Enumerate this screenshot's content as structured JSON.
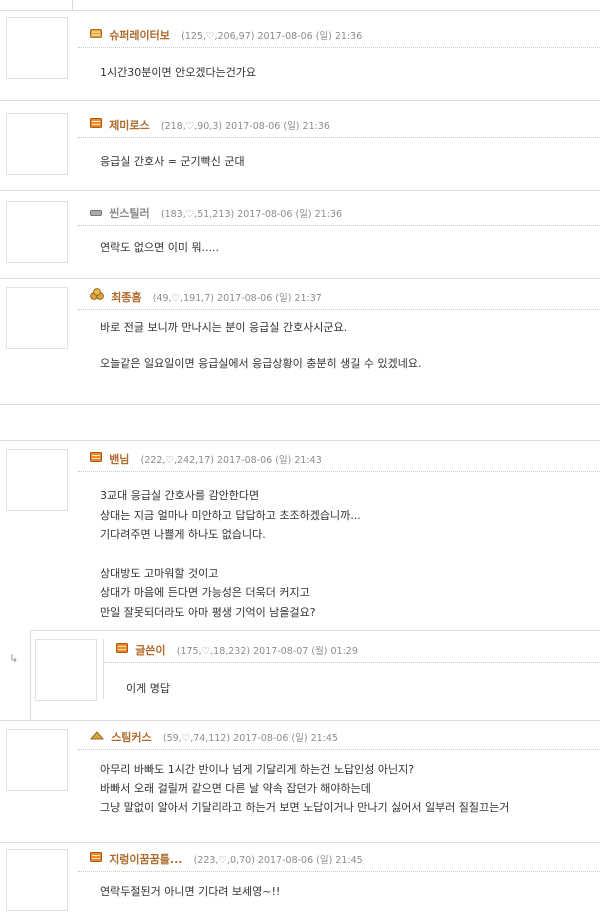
{
  "comments": [
    {
      "nick": "슈퍼레이터보",
      "meta": "(125,♡,206,97) 2017-08-06 (일) 21:36",
      "lines": [
        "1시간30분이면 안오겠다는건가요"
      ]
    },
    {
      "nick": "제미로스",
      "meta": "(218,♡,90,3) 2017-08-06 (일) 21:36",
      "lines": [
        "응급실 간호사 = 군기빡신 군대"
      ]
    },
    {
      "nick": "씬스틸러",
      "meta": "(183,♡,51,213) 2017-08-06 (일) 21:36",
      "lines": [
        "연락도 없으면 이미 뭐....."
      ]
    },
    {
      "nick": "최종흠",
      "meta": "(49,♡,191,7) 2017-08-06 (일) 21:37",
      "lines": [
        "바로 전글 보니까 만나시는 분이 응급실 간호사시군요.",
        "",
        "오늘같은 일요일이면 응급실에서 응급상황이 충분히 생길 수 있겠네요."
      ]
    },
    {
      "nick": "밴님",
      "meta": "(222,♡,242,17) 2017-08-06 (일) 21:43",
      "lines": [
        "3교대 응급실 간호사를 감안한다면",
        "상대는 지금 얼마나 미안하고 답답하고 초조하겠습니까...",
        "기다려주면 나쁠게 하나도 없습니다.",
        "",
        "상대방도 고마워할 것이고",
        "상대가 마음에 든다면 가능성은 더욱더 커지고",
        "만일 잘못되더라도 아마 평생 기억이 남을걸요?"
      ]
    },
    {
      "nick": "글쓴이",
      "meta": "(175,♡,18,232) 2017-08-07 (월) 01:29",
      "lines": [
        "이게 명답"
      ],
      "reply_arrow": "↳"
    },
    {
      "nick": "스팀커스",
      "meta": "(59,♡,74,112) 2017-08-06 (일) 21:45",
      "lines": [
        "아무리 바빠도 1시간 반이나 넘게 기달리게 하는건 노답인성 아닌지?",
        "바빠서 오래 걸릴꺼 같으면 다른 날 약속 잡던가 해야하는데",
        "그냥 말없이 알아서 기달리라고 하는거 보면 노답이거나 만나기 싫어서 일부러 질질끄는거"
      ]
    },
    {
      "nick": "지렁이꿈꿈틀...",
      "meta": "(223,♡,0,70) 2017-08-06 (일) 21:45",
      "lines": [
        "연락두절된거 아니면 기다려 보세영~!!"
      ]
    }
  ],
  "colors": {
    "nick": "#b06a2c",
    "border": "#dcdcdc",
    "text": "#333333",
    "meta": "#8c8c8c"
  },
  "icons": [
    "level-icon-gold",
    "level-icon-orange",
    "level-icon-gray",
    "level-icon-coins"
  ]
}
